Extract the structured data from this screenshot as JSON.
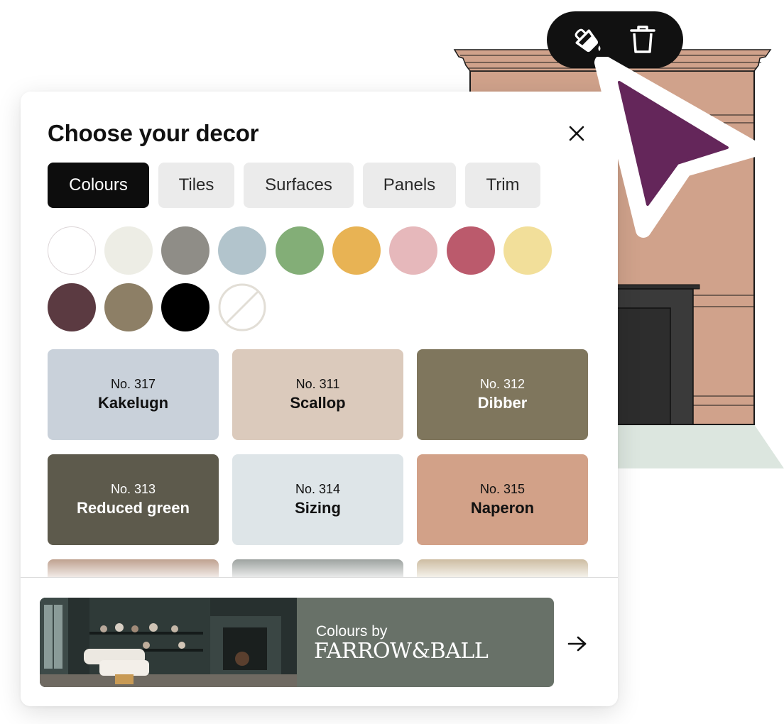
{
  "toolbar": {
    "fill_icon": "paint-bucket-icon",
    "delete_icon": "trash-icon"
  },
  "cursor": {
    "icon": "pointer-arrow-icon",
    "color": "#64265a"
  },
  "panel": {
    "title": "Choose your decor",
    "close_icon": "close-icon",
    "tabs": [
      {
        "label": "Colours",
        "active": true
      },
      {
        "label": "Tiles",
        "active": false
      },
      {
        "label": "Surfaces",
        "active": false
      },
      {
        "label": "Panels",
        "active": false
      },
      {
        "label": "Trim",
        "active": false
      }
    ],
    "swatches": [
      "#ffffff",
      "#edede5",
      "#8f8d87",
      "#b2c4cc",
      "#83ae77",
      "#e8b354",
      "#e6b8bb",
      "#bb5a6c",
      "#f2df9a",
      "#5b3a41",
      "#8d7f66",
      "#000000",
      "none"
    ],
    "cards": [
      {
        "number": "No. 317",
        "name": "Kakelugn",
        "color": "#c9d1da",
        "text": "#111111"
      },
      {
        "number": "No. 311",
        "name": "Scallop",
        "color": "#dbcabc",
        "text": "#111111"
      },
      {
        "number": "No. 312",
        "name": "Dibber",
        "color": "#7f765d",
        "text": "#ffffff"
      },
      {
        "number": "No. 313",
        "name": "Reduced green",
        "color": "#5d5a4c",
        "text": "#ffffff"
      },
      {
        "number": "No. 314",
        "name": "Sizing",
        "color": "#dee5e8",
        "text": "#111111"
      },
      {
        "number": "No. 315",
        "name": "Naperon",
        "color": "#d2a188",
        "text": "#111111"
      }
    ],
    "peek_cards": [
      "#9a6a4e",
      "#646c68",
      "#b0976b"
    ]
  },
  "banner": {
    "colours_by": "Colours by",
    "brand": "FARROW&BALL",
    "arrow_icon": "arrow-right-icon"
  }
}
